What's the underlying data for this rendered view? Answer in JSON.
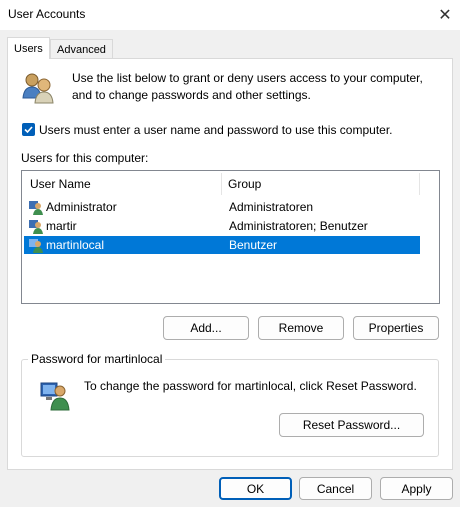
{
  "window": {
    "title": "User Accounts"
  },
  "tabs": [
    {
      "label": "Users",
      "active": true
    },
    {
      "label": "Advanced",
      "active": false
    }
  ],
  "intro_text_1": "Use the list below to grant or deny users access to your computer,",
  "intro_text_2": "and to change passwords and other settings.",
  "require_login": {
    "label": "Users must enter a user name and password to use this computer.",
    "checked": true
  },
  "users_label": "Users for this computer:",
  "table": {
    "columns": [
      "User Name",
      "Group"
    ],
    "rows": [
      {
        "name": "Administrator",
        "group": "Administratoren",
        "selected": false
      },
      {
        "name": "martir",
        "group": "Administratoren; Benutzer",
        "selected": false
      },
      {
        "name": "martinlocal",
        "group": "Benutzer",
        "selected": true
      }
    ]
  },
  "user_buttons": {
    "add": "Add...",
    "remove": "Remove",
    "properties": "Properties"
  },
  "password_group": {
    "title": "Password for martinlocal",
    "text": "To change the password for martinlocal, click Reset Password.",
    "reset_button": "Reset Password..."
  },
  "footer": {
    "ok": "OK",
    "cancel": "Cancel",
    "apply": "Apply"
  },
  "colors": {
    "accent": "#005fb8",
    "selection": "#0078d7"
  }
}
